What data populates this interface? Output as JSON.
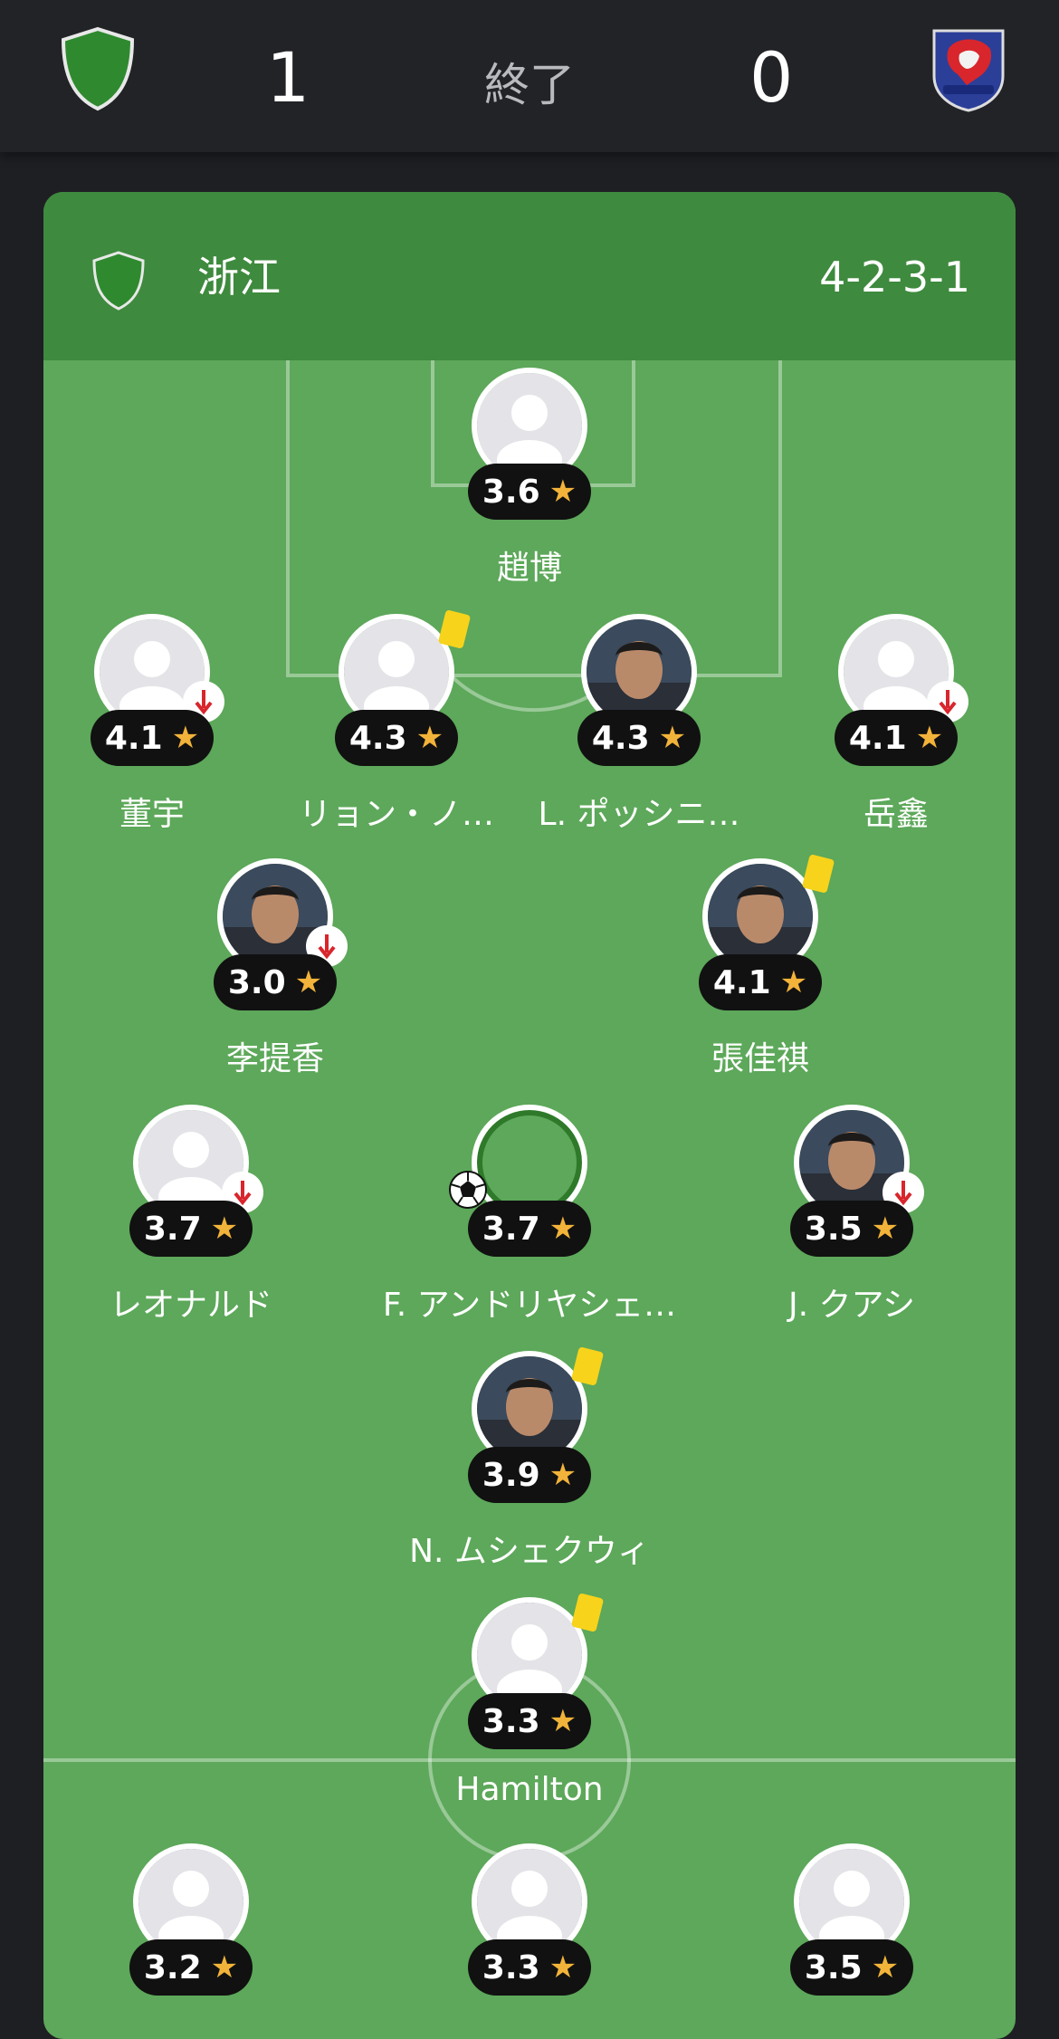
{
  "match": {
    "home_score": "1",
    "away_score": "0",
    "status": "終了",
    "home_badge_icon": "green-shield-icon",
    "away_badge_icon": "lion-crest-icon"
  },
  "team": {
    "name": "浙江",
    "formation": "4-2-3-1",
    "color": "#3e8a3e"
  },
  "players": [
    {
      "id": "gk",
      "name": "趙博",
      "rating": "3.6",
      "team": "home"
    },
    {
      "id": "d1",
      "name": "董宇",
      "rating": "4.1",
      "team": "home",
      "sub": true
    },
    {
      "id": "d2",
      "name": "リョン・ノ…",
      "rating": "4.3",
      "team": "home",
      "yellow": true
    },
    {
      "id": "d3",
      "name": "L. ポッシニ…",
      "rating": "4.3",
      "team": "home",
      "photo": true
    },
    {
      "id": "d4",
      "name": "岳鑫",
      "rating": "4.1",
      "team": "home",
      "sub": true
    },
    {
      "id": "m1",
      "name": "李提香",
      "rating": "3.0",
      "team": "home",
      "sub": true,
      "photo": true
    },
    {
      "id": "m2",
      "name": "張佳祺",
      "rating": "4.1",
      "team": "home",
      "yellow": true,
      "photo": true
    },
    {
      "id": "a1",
      "name": "レオナルド",
      "rating": "3.7",
      "team": "home",
      "sub": true
    },
    {
      "id": "a2",
      "name": "F. アンドリヤシェ…",
      "rating": "3.7",
      "team": "home",
      "goal": true
    },
    {
      "id": "a3",
      "name": "J. クアシ",
      "rating": "3.5",
      "team": "home",
      "sub": true,
      "photo": true
    },
    {
      "id": "st",
      "name": "N. ムシェクウィ",
      "rating": "3.9",
      "team": "home",
      "yellow": true,
      "photo": true
    },
    {
      "id": "o1",
      "name": "Hamilton",
      "rating": "3.3",
      "team": "away",
      "yellow": true
    },
    {
      "id": "o2",
      "name": "",
      "rating": "3.2",
      "team": "away"
    },
    {
      "id": "o3",
      "name": "",
      "rating": "3.3",
      "team": "away"
    },
    {
      "id": "o4",
      "name": "",
      "rating": "3.5",
      "team": "away"
    }
  ],
  "star_glyph": "★",
  "colors": {
    "pitch": "#5da85a",
    "rating_star": "#f2b33a",
    "yellow_card": "#f7d31b",
    "sub_arrow": "#d8262c"
  }
}
